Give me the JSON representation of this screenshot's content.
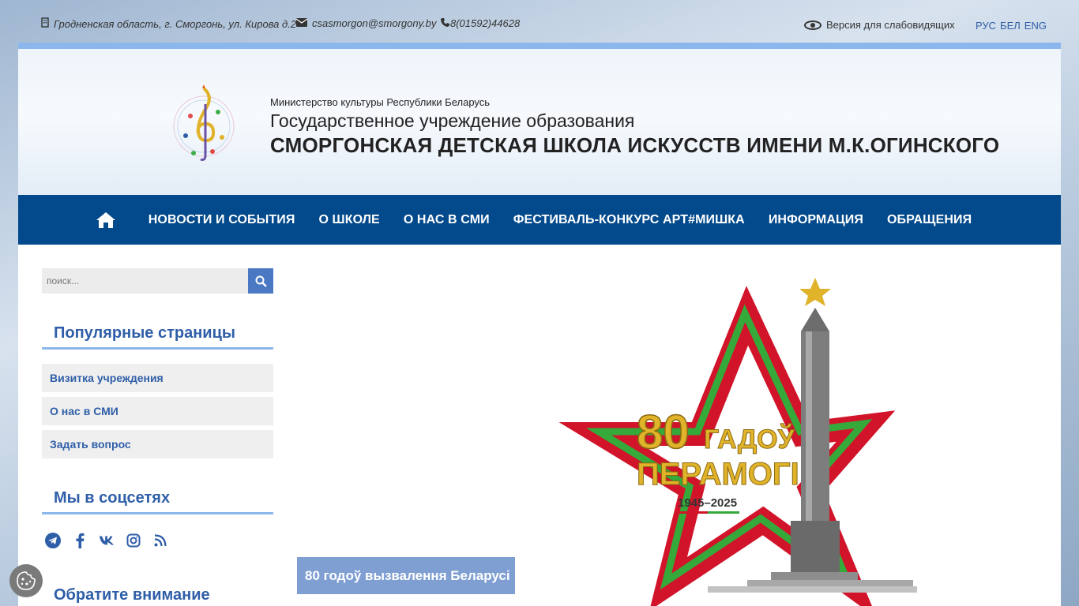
{
  "topbar": {
    "address": "Гродненская область, г. Сморгонь, ул. Кирова д.2",
    "email": "csasmorgon@smorgony.by",
    "phone": "8(01592)44628",
    "vision_label": "Версия для слабовидящих",
    "languages": [
      "РУС",
      "БЕЛ",
      "ENG"
    ]
  },
  "header": {
    "ministry": "Министерство культуры Республики Беларусь",
    "institution_type": "Государственное учреждение образования",
    "institution_name": "СМОРГОНСКАЯ ДЕТСКАЯ ШКОЛА ИСКУССТВ ИМЕНИ М.К.ОГИНСКОГО"
  },
  "nav": {
    "items": [
      "НОВОСТИ И СОБЫТИЯ",
      "О ШКОЛЕ",
      "О НАС В СМИ",
      "ФЕСТИВАЛЬ-КОНКУРС АРТ#МИШКА",
      "ИНФОРМАЦИЯ",
      "ОБРАЩЕНИЯ"
    ]
  },
  "sidebar": {
    "search_placeholder": "поиск...",
    "popular_title": "Популярные страницы",
    "popular_items": [
      "Визитка учреждения",
      "О нас в СМИ",
      "Задать вопрос"
    ],
    "social_title": "Мы в соцсетях",
    "social_icons": [
      "telegram-icon",
      "facebook-icon",
      "vk-icon",
      "instagram-icon",
      "rss-icon"
    ],
    "notice_title": "Обратите внимание"
  },
  "banner": {
    "caption": "80 годоў вызвалення Беларусі",
    "art_number": "80",
    "art_line1": "ГАДОЎ",
    "art_line2": "ПЕРАМОГІ",
    "art_years": "1945–2025"
  },
  "colors": {
    "nav_bg": "#034a8c",
    "accent": "#2f5ea8",
    "accent_light": "#8cb7ec",
    "caption_bg": "#7f9fd2"
  }
}
